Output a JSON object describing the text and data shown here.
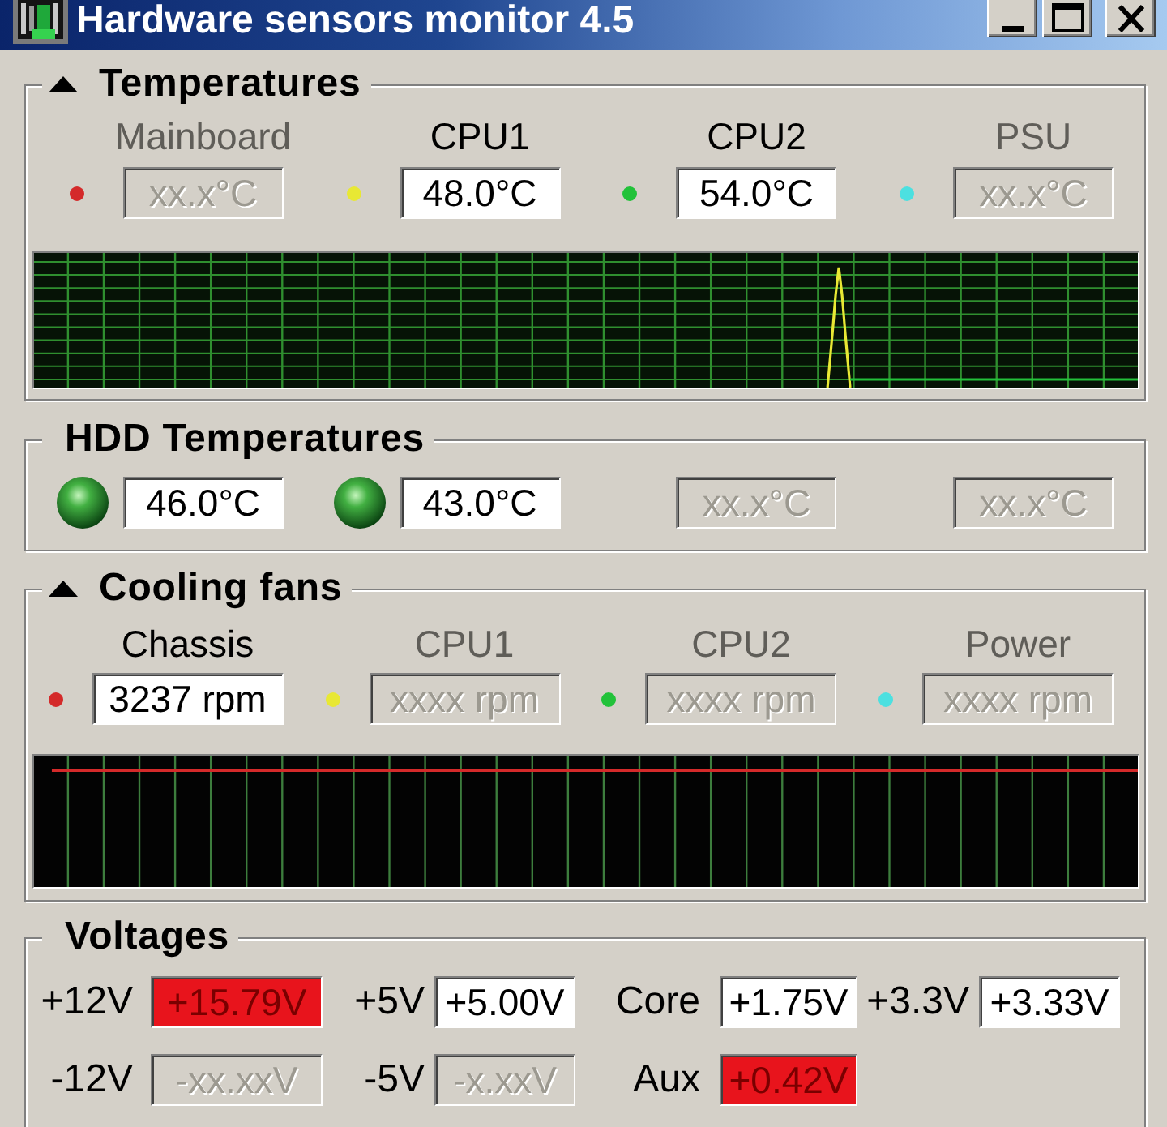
{
  "window": {
    "title": "Hardware sensors monitor 4.5"
  },
  "temperatures": {
    "title": "Temperatures",
    "collapsible": true,
    "sensors": [
      {
        "label": "Mainboard",
        "value": "xx.x°C",
        "disabled": true,
        "color": "#d42a2a"
      },
      {
        "label": "CPU1",
        "value": "48.0°C",
        "disabled": false,
        "color": "#e8e834"
      },
      {
        "label": "CPU2",
        "value": "54.0°C",
        "disabled": false,
        "color": "#22c23a"
      },
      {
        "label": "PSU",
        "value": "xx.x°C",
        "disabled": true,
        "color": "#4ce0e0"
      }
    ]
  },
  "hdd_temperatures": {
    "title": "HDD Temperatures",
    "collapsible": false,
    "drives": [
      {
        "value": "46.0°C",
        "disabled": false
      },
      {
        "value": "43.0°C",
        "disabled": false
      },
      {
        "value": "xx.x°C",
        "disabled": true
      },
      {
        "value": "xx.x°C",
        "disabled": true
      }
    ]
  },
  "cooling_fans": {
    "title": "Cooling fans",
    "collapsible": true,
    "fans": [
      {
        "label": "Chassis",
        "value": "3237 rpm",
        "disabled": false,
        "color": "#d42a2a"
      },
      {
        "label": "CPU1",
        "value": "xxxx rpm",
        "disabled": true,
        "color": "#e8e834"
      },
      {
        "label": "CPU2",
        "value": "xxxx rpm",
        "disabled": true,
        "color": "#22c23a"
      },
      {
        "label": "Power",
        "value": "xxxx rpm",
        "disabled": true,
        "color": "#4ce0e0"
      }
    ]
  },
  "voltages": {
    "title": "Voltages",
    "collapsible": false,
    "items": [
      {
        "label": "+12V",
        "value": "+15.79V",
        "alarm": true,
        "disabled": false
      },
      {
        "label": "+5V",
        "value": "+5.00V",
        "alarm": false,
        "disabled": false
      },
      {
        "label": "Core",
        "value": "+1.75V",
        "alarm": false,
        "disabled": false
      },
      {
        "label": "+3.3V",
        "value": "+3.33V",
        "alarm": false,
        "disabled": false
      },
      {
        "label": "-12V",
        "value": "-xx.xxV",
        "alarm": false,
        "disabled": true
      },
      {
        "label": "-5V",
        "value": "-x.xxV",
        "alarm": false,
        "disabled": true
      },
      {
        "label": "Aux",
        "value": "+0.42V",
        "alarm": true,
        "disabled": false
      }
    ]
  }
}
